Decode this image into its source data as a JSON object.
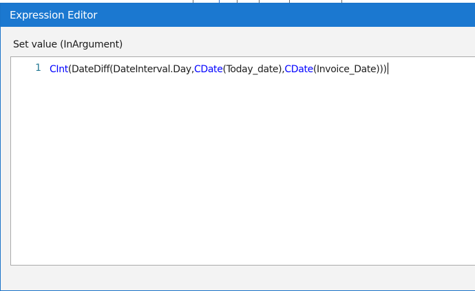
{
  "window": {
    "title": "Expression Editor"
  },
  "field": {
    "label": "Set value (InArgument)"
  },
  "editor": {
    "line_number": "1",
    "tokens": [
      {
        "text": "CInt",
        "keyword": true
      },
      {
        "text": "(DateDiff(DateInterval.Day,",
        "keyword": false
      },
      {
        "text": "CDate",
        "keyword": true
      },
      {
        "text": "(Today_date),",
        "keyword": false
      },
      {
        "text": "CDate",
        "keyword": true
      },
      {
        "text": "(Invoice_Date)))",
        "keyword": false
      }
    ]
  },
  "colors": {
    "titlebar": "#1b78d0",
    "keyword": "#0000ff",
    "line_number": "#237893"
  }
}
